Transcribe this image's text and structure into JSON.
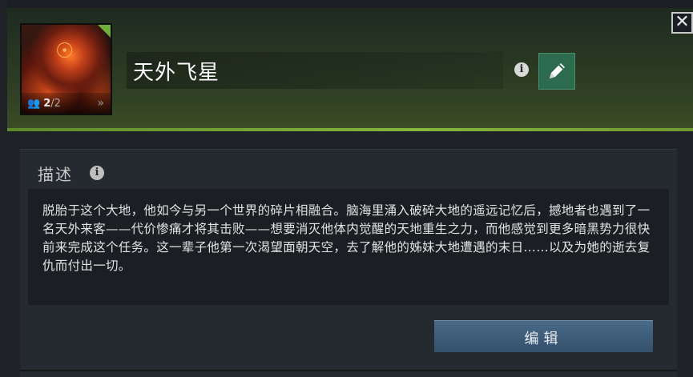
{
  "header": {
    "title": "天外飞星",
    "player_count": {
      "current": "2",
      "separator": "/",
      "max": "2"
    },
    "icons": {
      "portrait": "hero-portrait",
      "players": "players-icon",
      "expand": "double-chevron-right-icon",
      "info": "info-icon",
      "edit": "pencil-icon",
      "close": "close-icon"
    },
    "close_glyph": "✕"
  },
  "description": {
    "label": "描述",
    "text": "脱胎于这个大地，他如今与另一个世界的碎片相融合。脑海里涌入破碎大地的遥远记忆后，撼地者也遇到了一名天外来客——代价惨痛才将其击败——想要消灭他体内觉醒的天地重生之力，而他感觉到更多暗黑势力很快前来完成这个任务。这一辈子他第一次渴望面朝天空，去了解他的姊妹大地遭遇的末日……以及为她的逝去复仇而付出一切。"
  },
  "actions": {
    "edit_label": "编辑"
  },
  "colors": {
    "accent_green": "#86b63b",
    "edit_button": "#2d6b4e",
    "primary_button": "#3f5e7a"
  }
}
